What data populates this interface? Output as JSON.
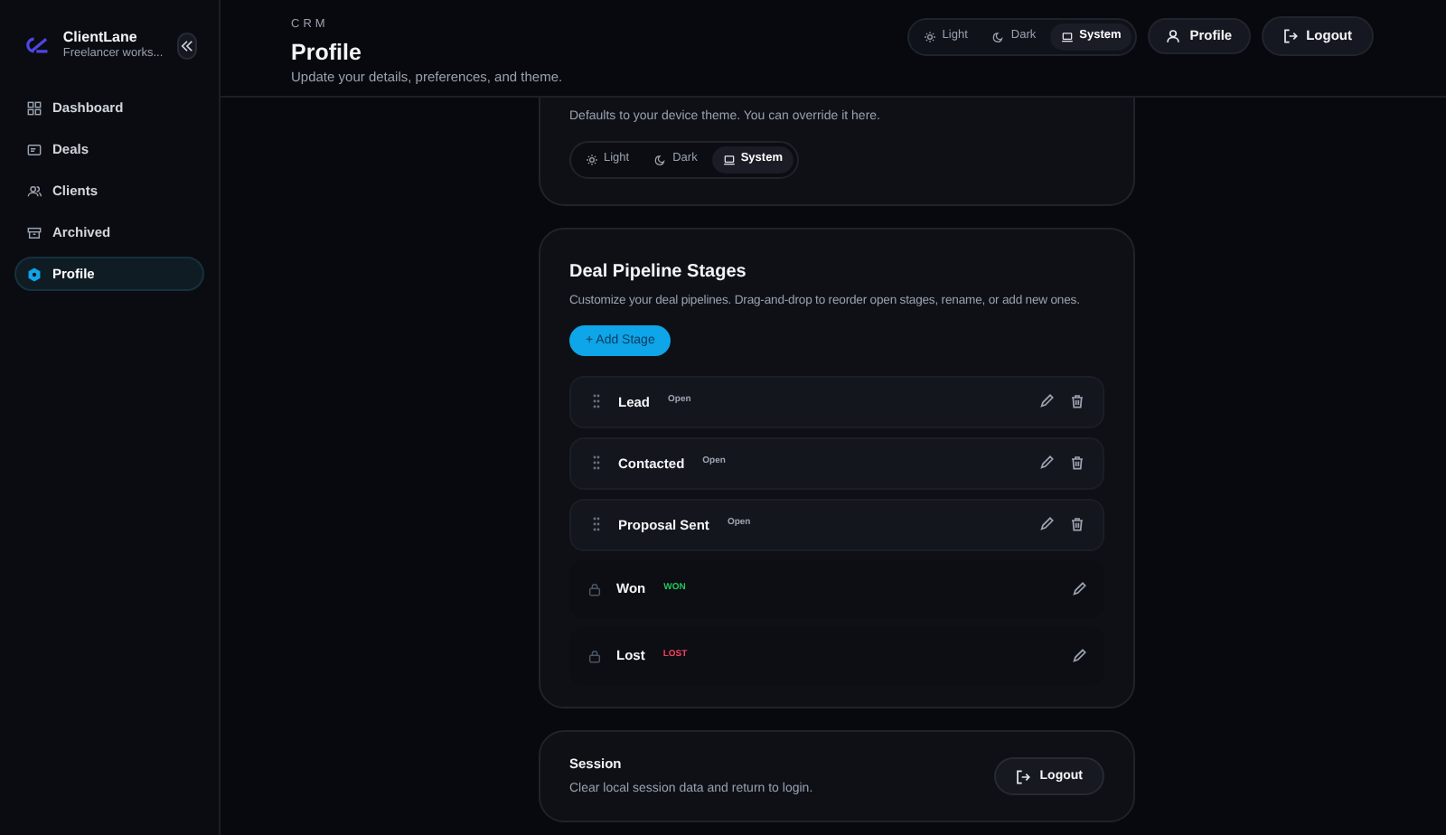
{
  "brand": {
    "name": "ClientLane",
    "subtitle": "Freelancer works..."
  },
  "nav": [
    {
      "label": "Dashboard",
      "selected": false
    },
    {
      "label": "Deals",
      "selected": false
    },
    {
      "label": "Clients",
      "selected": false
    },
    {
      "label": "Archived",
      "selected": false
    },
    {
      "label": "Profile",
      "selected": true
    }
  ],
  "header": {
    "eyebrow": "CRM",
    "title": "Profile",
    "subtitle": "Update your details, preferences, and theme.",
    "theme": [
      {
        "label": "Light",
        "selected": false
      },
      {
        "label": "Dark",
        "selected": false
      },
      {
        "label": "System",
        "selected": true
      }
    ],
    "profile_button": "Profile",
    "logout_button": "Logout"
  },
  "appearance": {
    "description": "Defaults to your device theme. You can override it here.",
    "theme": [
      {
        "label": "Light",
        "selected": false
      },
      {
        "label": "Dark",
        "selected": false
      },
      {
        "label": "System",
        "selected": true
      }
    ]
  },
  "pipeline": {
    "title": "Deal Pipeline Stages",
    "description": "Customize your deal pipelines. Drag-and-drop to reorder open stages, rename, or add new ones.",
    "add_button": "+ Add Stage",
    "stages": [
      {
        "kind": "open",
        "name": "Lead",
        "badge": "Open",
        "color": "#9ca3af"
      },
      {
        "kind": "open",
        "name": "Contacted",
        "badge": "Open",
        "color": "#9ca3af"
      },
      {
        "kind": "open",
        "name": "Proposal Sent",
        "badge": "Open",
        "color": "#9ca3af"
      },
      {
        "kind": "closed",
        "name": "Won",
        "badge": "WON",
        "color": "#22c55e"
      },
      {
        "kind": "closed",
        "name": "Lost",
        "badge": "LOST",
        "color": "#f43f5e"
      }
    ]
  },
  "session": {
    "title": "Session",
    "description": "Clear local session data and return to login.",
    "button": "Logout"
  }
}
